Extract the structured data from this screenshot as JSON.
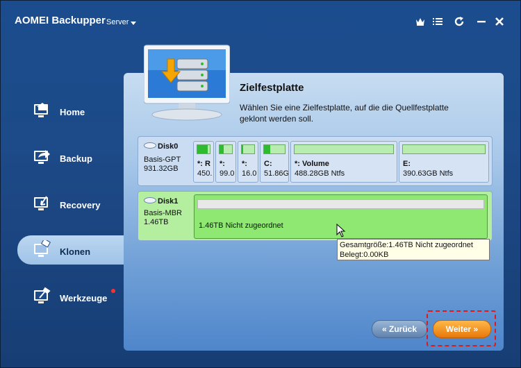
{
  "app": {
    "title": "AOMEI Backupper",
    "edition": "Server"
  },
  "window_controls": {
    "upgrade": "crown-icon",
    "menu": "list-icon",
    "refresh": "refresh-icon",
    "minimize": "minimize-icon",
    "close": "close-icon"
  },
  "sidebar": {
    "items": [
      {
        "label": "Home",
        "icon": "home-icon",
        "active": false
      },
      {
        "label": "Backup",
        "icon": "backup-icon",
        "active": false
      },
      {
        "label": "Recovery",
        "icon": "recovery-icon",
        "active": false
      },
      {
        "label": "Klonen",
        "icon": "clone-icon",
        "active": true
      },
      {
        "label": "Werkzeuge",
        "icon": "tools-icon",
        "active": false,
        "notification": true
      }
    ]
  },
  "main": {
    "heading": "Zielfestplatte",
    "description": "Wählen Sie eine Zielfestplatte, auf die die Quellfestplatte geklont werden soll."
  },
  "disks": [
    {
      "name": "Disk0",
      "type": "Basis-GPT",
      "size": "931.32GB",
      "partitions": [
        {
          "label": "*: R",
          "value": "450.",
          "used": 0.85
        },
        {
          "label": "*:",
          "value": "99.0",
          "used": 0.35
        },
        {
          "label": "*:",
          "value": "16.0",
          "used": 0.1
        },
        {
          "label": "C:",
          "value": "51.86G",
          "used": 0.3
        },
        {
          "label": "*: Volume",
          "value": "488.28GB Ntfs",
          "used": 0.0
        },
        {
          "label": "E:",
          "value": "390.63GB Ntfs",
          "used": 0.0
        }
      ]
    },
    {
      "name": "Disk1",
      "type": "Basis-MBR",
      "size": "1.46TB",
      "partitions": [
        {
          "label": "",
          "value": "1.46TB Nicht zugeordnet",
          "used": 0.0
        }
      ]
    }
  ],
  "tooltip": {
    "line1": "Gesamtgröße:1.46TB Nicht zugeordnet",
    "line2": "Belegt:0.00KB"
  },
  "buttons": {
    "back": "« Zurück",
    "next": "Weiter »"
  },
  "colors": {
    "accent": "#1d4a88",
    "next_button": "#e8780a",
    "selected_disk": "#8ee872",
    "highlight": "#e01818"
  }
}
